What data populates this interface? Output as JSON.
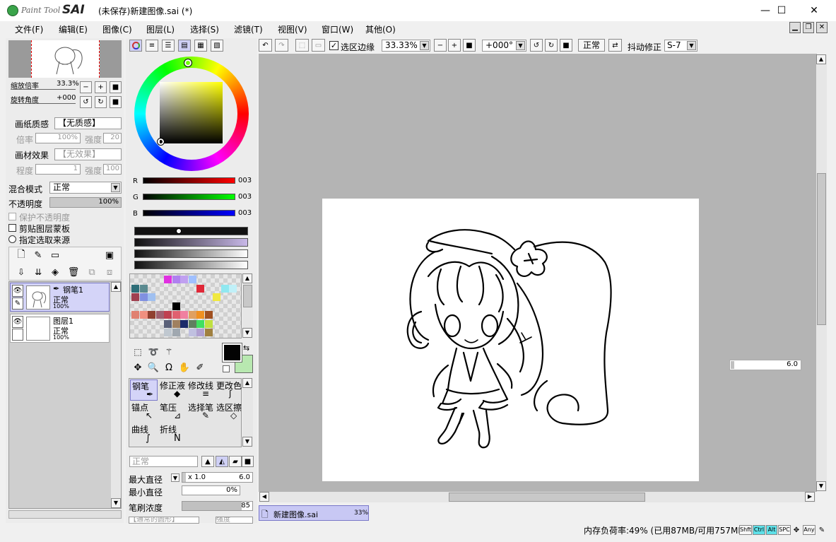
{
  "window": {
    "logo_small": "Paint Tool",
    "logo_big": "SAI",
    "title": "(未保存)新建图像.sai (*)",
    "minimize": "—",
    "maximize": "☐",
    "close": "✕"
  },
  "menu": [
    "文件(F)",
    "编辑(E)",
    "图像(C)",
    "图层(L)",
    "选择(S)",
    "滤镜(T)",
    "视图(V)",
    "窗口(W)",
    "其他(O)"
  ],
  "navigator": {
    "zoom_label": "缩放倍率",
    "zoom_value": "33.3%",
    "rotate_label": "旋转角度",
    "rotate_value": "+000"
  },
  "paper": {
    "texture_label": "画纸质感",
    "texture_value": "【无质感】",
    "scale_label": "倍率",
    "scale_value": "100%",
    "strength_label": "强度",
    "strength_value": "20",
    "effect_label": "画材效果",
    "effect_value": "【无效果】",
    "degree_label": "程度",
    "degree_value": "1",
    "strength2_label": "强度",
    "strength2_value": "100"
  },
  "layer_opts": {
    "blend_label": "混合模式",
    "blend_value": "正常",
    "opacity_label": "不透明度",
    "opacity_value": "100%",
    "protect_opacity": "保护不透明度",
    "clip_mask": "剪贴图层蒙板",
    "selection_source": "指定选取来源"
  },
  "layers": [
    {
      "name": "钢笔1",
      "mode": "正常",
      "opacity": "100%",
      "selected": true
    },
    {
      "name": "图层1",
      "mode": "正常",
      "opacity": "100%",
      "selected": false
    }
  ],
  "color": {
    "r_label": "R",
    "r_value": "003",
    "g_label": "G",
    "g_value": "003",
    "b_label": "B",
    "b_value": "003",
    "main_color": "#030303",
    "sub_color": "#b8e8b0"
  },
  "tools": [
    {
      "label": "钢笔",
      "selected": true
    },
    {
      "label": "修正液",
      "selected": false
    },
    {
      "label": "修改线",
      "selected": false
    },
    {
      "label": "更改色",
      "selected": false
    },
    {
      "label": "锚点",
      "selected": false
    },
    {
      "label": "笔压",
      "selected": false
    },
    {
      "label": "选择笔",
      "selected": false
    },
    {
      "label": "选区擦",
      "selected": false
    },
    {
      "label": "曲线",
      "selected": false
    },
    {
      "label": "折线",
      "selected": false
    }
  ],
  "brush": {
    "mode_value": "正常",
    "max_size_label": "最大直径",
    "max_size_mult": "x 1.0",
    "max_size_value": "6.0",
    "min_size_label": "最小直径",
    "min_size_value": "0%",
    "density_label": "笔刷浓度",
    "density_value": "85",
    "bottom_label": "【通常的圆形】",
    "bottom_value": "强度"
  },
  "toolbar": {
    "selection_edge_label": "选区边缘",
    "zoom_value": "33.33%",
    "rotate_value": "+000°",
    "mode_value": "正常",
    "stabilizer_label": "抖动修正",
    "stabilizer_value": "S-7"
  },
  "canvas": {
    "size_popup_value": "6.0"
  },
  "doc_tab": {
    "name": "新建图像.sai",
    "zoom": "33%"
  },
  "status": {
    "memory": "内存负荷率:49% (已用87MB/可用757MB)",
    "keys": [
      "Shft",
      "Ctrl",
      "Alt",
      "SPC",
      "Any"
    ]
  }
}
